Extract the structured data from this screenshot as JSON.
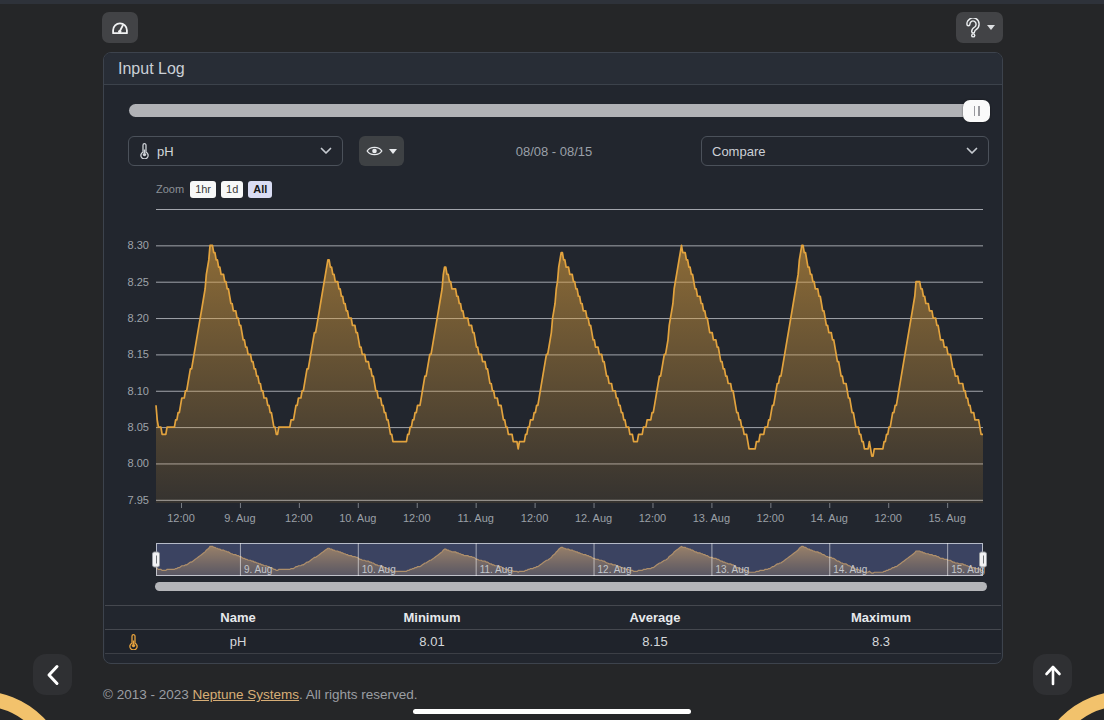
{
  "topbar": {
    "dashboard_button": {
      "icon": "gauge-icon"
    },
    "help_button": {
      "icon": "help-icon"
    }
  },
  "panel": {
    "title": "Input Log"
  },
  "controls": {
    "probe_select": {
      "value": "pH",
      "icon": "thermometer-icon"
    },
    "visibility_button": {
      "icon": "eye-icon"
    },
    "date_range": "08/08 - 08/15",
    "compare_select": {
      "value": "Compare"
    }
  },
  "chart_data": {
    "type": "area",
    "title": "",
    "series_name": "pH",
    "series_color": "#e2a33e",
    "zoom": {
      "label": "Zoom",
      "buttons": [
        "1hr",
        "1d",
        "All"
      ],
      "selected": "All"
    },
    "ylim": [
      7.9456,
      8.35
    ],
    "yticks": [
      7.95,
      8.0,
      8.05,
      8.1,
      8.15,
      8.2,
      8.25,
      8.3
    ],
    "ytick_labels": [
      "7.95",
      "8.00",
      "8.05",
      "8.10",
      "8.15",
      "8.20",
      "8.25",
      "8.30"
    ],
    "grid": "horizontal-only",
    "xlim_hours": [
      6.91,
      175.3
    ],
    "xticks": [
      {
        "t": 12,
        "label": "12:00"
      },
      {
        "t": 24,
        "label": "9. Aug"
      },
      {
        "t": 36,
        "label": "12:00"
      },
      {
        "t": 48,
        "label": "10. Aug"
      },
      {
        "t": 60,
        "label": "12:00"
      },
      {
        "t": 72,
        "label": "11. Aug"
      },
      {
        "t": 84,
        "label": "12:00"
      },
      {
        "t": 96,
        "label": "12. Aug"
      },
      {
        "t": 108,
        "label": "12:00"
      },
      {
        "t": 120,
        "label": "13. Aug"
      },
      {
        "t": 132,
        "label": "12:00"
      },
      {
        "t": 144,
        "label": "14. Aug"
      },
      {
        "t": 156,
        "label": "12:00"
      },
      {
        "t": 168,
        "label": "15. Aug"
      }
    ],
    "series": {
      "name": "pH",
      "t0": 6.91,
      "dt": 0.25,
      "t_end": 175.3,
      "values": [
        8.08,
        8.06,
        8.05,
        8.05,
        8.05,
        8.04,
        8.04,
        8.04,
        8.04,
        8.05,
        8.05,
        8.05,
        8.05,
        8.05,
        8.05,
        8.05,
        8.06,
        8.06,
        8.07,
        8.07,
        8.08,
        8.09,
        8.09,
        8.09,
        8.1,
        8.1,
        8.11,
        8.12,
        8.13,
        8.13,
        8.14,
        8.15,
        8.16,
        8.17,
        8.18,
        8.19,
        8.2,
        8.21,
        8.22,
        8.23,
        8.24,
        8.26,
        8.27,
        8.28,
        8.3,
        8.3,
        8.3,
        8.29,
        8.29,
        8.28,
        8.28,
        8.27,
        8.27,
        8.26,
        8.26,
        8.26,
        8.25,
        8.25,
        8.24,
        8.24,
        8.23,
        8.22,
        8.22,
        8.21,
        8.21,
        8.21,
        8.2,
        8.2,
        8.19,
        8.19,
        8.18,
        8.17,
        8.17,
        8.16,
        8.16,
        8.15,
        8.15,
        8.15,
        8.14,
        8.14,
        8.13,
        8.13,
        8.12,
        8.12,
        8.11,
        8.11,
        8.1,
        8.1,
        8.09,
        8.09,
        8.09,
        8.08,
        8.08,
        8.07,
        8.07,
        8.06,
        8.05,
        8.05,
        8.04,
        8.04,
        8.05,
        8.05,
        8.05,
        8.05,
        8.05,
        8.05,
        8.05,
        8.05,
        8.05,
        8.05,
        8.06,
        8.06,
        8.06,
        8.07,
        8.08,
        8.08,
        8.09,
        8.09,
        8.09,
        8.1,
        8.1,
        8.11,
        8.12,
        8.13,
        8.13,
        8.14,
        8.15,
        8.16,
        8.17,
        8.18,
        8.18,
        8.19,
        8.2,
        8.21,
        8.22,
        8.23,
        8.24,
        8.25,
        8.26,
        8.27,
        8.28,
        8.28,
        8.27,
        8.27,
        8.26,
        8.26,
        8.25,
        8.25,
        8.25,
        8.24,
        8.24,
        8.23,
        8.23,
        8.22,
        8.22,
        8.21,
        8.21,
        8.2,
        8.2,
        8.2,
        8.19,
        8.19,
        8.19,
        8.18,
        8.18,
        8.17,
        8.16,
        8.16,
        8.15,
        8.15,
        8.15,
        8.14,
        8.14,
        8.14,
        8.13,
        8.13,
        8.12,
        8.12,
        8.11,
        8.1,
        8.1,
        8.09,
        8.09,
        8.09,
        8.08,
        8.08,
        8.07,
        8.07,
        8.06,
        8.06,
        8.05,
        8.04,
        8.04,
        8.03,
        8.03,
        8.03,
        8.03,
        8.03,
        8.03,
        8.03,
        8.03,
        8.03,
        8.03,
        8.03,
        8.03,
        8.04,
        8.04,
        8.05,
        8.05,
        8.06,
        8.06,
        8.07,
        8.07,
        8.08,
        8.08,
        8.08,
        8.09,
        8.1,
        8.11,
        8.12,
        8.12,
        8.13,
        8.14,
        8.15,
        8.15,
        8.16,
        8.17,
        8.18,
        8.19,
        8.2,
        8.21,
        8.22,
        8.23,
        8.24,
        8.26,
        8.27,
        8.27,
        8.26,
        8.26,
        8.25,
        8.25,
        8.24,
        8.24,
        8.24,
        8.24,
        8.23,
        8.23,
        8.22,
        8.22,
        8.21,
        8.21,
        8.2,
        8.2,
        8.2,
        8.2,
        8.19,
        8.19,
        8.19,
        8.18,
        8.18,
        8.17,
        8.16,
        8.16,
        8.15,
        8.15,
        8.15,
        8.14,
        8.14,
        8.14,
        8.13,
        8.13,
        8.12,
        8.11,
        8.11,
        8.1,
        8.1,
        8.09,
        8.09,
        8.09,
        8.08,
        8.08,
        8.08,
        8.07,
        8.06,
        8.06,
        8.05,
        8.05,
        8.04,
        8.04,
        8.04,
        8.04,
        8.03,
        8.03,
        8.03,
        8.03,
        8.02,
        8.03,
        8.03,
        8.03,
        8.03,
        8.03,
        8.04,
        8.04,
        8.05,
        8.05,
        8.06,
        8.06,
        8.06,
        8.07,
        8.07,
        8.08,
        8.08,
        8.09,
        8.1,
        8.11,
        8.12,
        8.13,
        8.14,
        8.15,
        8.15,
        8.16,
        8.17,
        8.18,
        8.2,
        8.21,
        8.22,
        8.24,
        8.25,
        8.27,
        8.28,
        8.29,
        8.29,
        8.28,
        8.28,
        8.27,
        8.27,
        8.27,
        8.26,
        8.26,
        8.26,
        8.25,
        8.25,
        8.24,
        8.24,
        8.23,
        8.23,
        8.22,
        8.22,
        8.21,
        8.21,
        8.21,
        8.2,
        8.2,
        8.19,
        8.19,
        8.18,
        8.17,
        8.17,
        8.16,
        8.16,
        8.16,
        8.15,
        8.15,
        8.15,
        8.14,
        8.14,
        8.13,
        8.12,
        8.12,
        8.11,
        8.11,
        8.11,
        8.1,
        8.1,
        8.1,
        8.09,
        8.09,
        8.08,
        8.08,
        8.07,
        8.07,
        8.06,
        8.06,
        8.05,
        8.05,
        8.05,
        8.04,
        8.04,
        8.04,
        8.03,
        8.03,
        8.03,
        8.03,
        8.04,
        8.04,
        8.04,
        8.04,
        8.05,
        8.05,
        8.05,
        8.06,
        8.06,
        8.06,
        8.06,
        8.07,
        8.07,
        8.08,
        8.09,
        8.1,
        8.11,
        8.12,
        8.12,
        8.13,
        8.14,
        8.15,
        8.15,
        8.16,
        8.17,
        8.19,
        8.2,
        8.21,
        8.22,
        8.24,
        8.25,
        8.26,
        8.27,
        8.28,
        8.29,
        8.3,
        8.29,
        8.29,
        8.29,
        8.28,
        8.28,
        8.27,
        8.27,
        8.26,
        8.26,
        8.25,
        8.24,
        8.24,
        8.23,
        8.23,
        8.23,
        8.22,
        8.22,
        8.21,
        8.21,
        8.2,
        8.2,
        8.19,
        8.18,
        8.18,
        8.18,
        8.17,
        8.17,
        8.17,
        8.16,
        8.16,
        8.15,
        8.14,
        8.14,
        8.13,
        8.13,
        8.12,
        8.12,
        8.11,
        8.11,
        8.11,
        8.1,
        8.1,
        8.09,
        8.08,
        8.07,
        8.07,
        8.06,
        8.06,
        8.05,
        8.05,
        8.04,
        8.04,
        8.04,
        8.03,
        8.02,
        8.02,
        8.02,
        8.02,
        8.02,
        8.02,
        8.03,
        8.03,
        8.03,
        8.04,
        8.04,
        8.04,
        8.04,
        8.05,
        8.05,
        8.05,
        8.06,
        8.06,
        8.07,
        8.08,
        8.08,
        8.09,
        8.1,
        8.11,
        8.11,
        8.12,
        8.12,
        8.13,
        8.14,
        8.15,
        8.16,
        8.17,
        8.18,
        8.19,
        8.2,
        8.21,
        8.22,
        8.23,
        8.24,
        8.25,
        8.26,
        8.28,
        8.29,
        8.3,
        8.3,
        8.29,
        8.29,
        8.28,
        8.27,
        8.27,
        8.26,
        8.26,
        8.25,
        8.25,
        8.24,
        8.24,
        8.24,
        8.23,
        8.23,
        8.22,
        8.21,
        8.21,
        8.2,
        8.19,
        8.19,
        8.18,
        8.18,
        8.18,
        8.17,
        8.17,
        8.16,
        8.15,
        8.14,
        8.14,
        8.13,
        8.12,
        8.12,
        8.11,
        8.11,
        8.11,
        8.1,
        8.09,
        8.09,
        8.08,
        8.07,
        8.07,
        8.06,
        8.05,
        8.05,
        8.05,
        8.04,
        8.04,
        8.03,
        8.03,
        8.02,
        8.02,
        8.02,
        8.02,
        8.03,
        8.02,
        8.01,
        8.01,
        8.02,
        8.02,
        8.02,
        8.02,
        8.02,
        8.02,
        8.02,
        8.02,
        8.03,
        8.03,
        8.04,
        8.04,
        8.05,
        8.05,
        8.06,
        8.07,
        8.07,
        8.08,
        8.08,
        8.09,
        8.1,
        8.11,
        8.12,
        8.13,
        8.14,
        8.15,
        8.16,
        8.17,
        8.18,
        8.19,
        8.2,
        8.21,
        8.22,
        8.23,
        8.25,
        8.25,
        8.25,
        8.25,
        8.24,
        8.24,
        8.23,
        8.23,
        8.22,
        8.22,
        8.22,
        8.21,
        8.21,
        8.21,
        8.2,
        8.2,
        8.2,
        8.19,
        8.19,
        8.18,
        8.17,
        8.17,
        8.17,
        8.16,
        8.16,
        8.16,
        8.15,
        8.15,
        8.15,
        8.14,
        8.13,
        8.13,
        8.12,
        8.12,
        8.12,
        8.11,
        8.11,
        8.11,
        8.11,
        8.1,
        8.1,
        8.09,
        8.09,
        8.08,
        8.08,
        8.07,
        8.07,
        8.07,
        8.06,
        8.06,
        8.06,
        8.06,
        8.05,
        8.04,
        8.04,
        8.04
      ]
    },
    "navigator": {
      "labels": [
        {
          "t": 24,
          "label": "9. Aug"
        },
        {
          "t": 48,
          "label": "10. Aug"
        },
        {
          "t": 72,
          "label": "11. Aug"
        },
        {
          "t": 96,
          "label": "12. Aug"
        },
        {
          "t": 120,
          "label": "13. Aug"
        },
        {
          "t": 144,
          "label": "14. Aug"
        },
        {
          "t": 168,
          "label": "15. Aug"
        }
      ]
    }
  },
  "table": {
    "headers": [
      "Name",
      "Minimum",
      "Average",
      "Maximum"
    ],
    "rows": [
      {
        "icon": "thermometer-icon",
        "name": "pH",
        "minimum": "8.01",
        "average": "8.15",
        "maximum": "8.3"
      }
    ]
  },
  "footer": {
    "prefix": "© 2013 - 2023 ",
    "link": "Neptune Systems",
    "suffix": ". All rights reserved."
  }
}
